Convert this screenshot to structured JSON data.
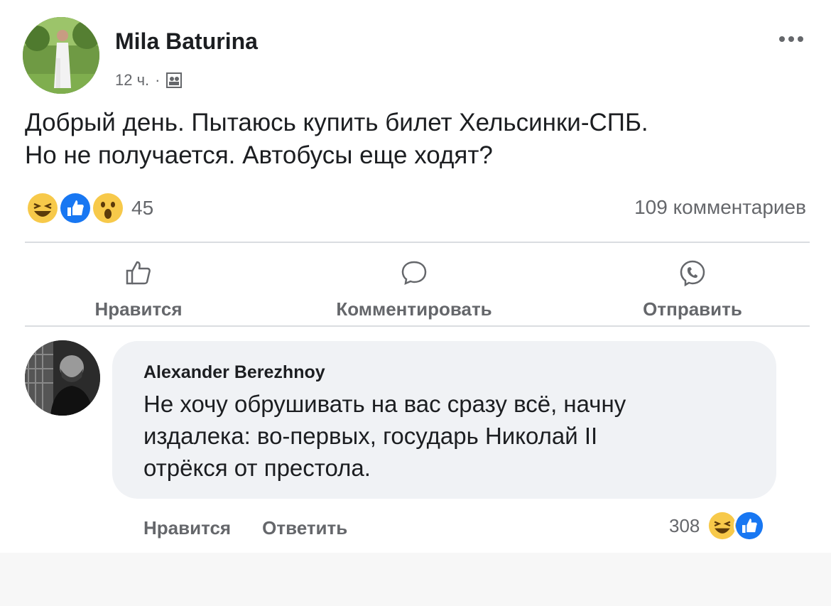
{
  "post": {
    "author": "Mila Baturina",
    "time": "12 ч.",
    "separator": "·",
    "text_line1": "Добрый день. Пытаюсь купить билет Хельсинки-СПБ.",
    "text_line2": "Но не получается. Автобусы еще ходят?",
    "reactions_count": "45",
    "reactions": [
      "haha-icon",
      "like-icon",
      "wow-icon"
    ],
    "comments_count": "109 комментариев"
  },
  "actions": {
    "like": "Нравится",
    "comment": "Комментировать",
    "send": "Отправить"
  },
  "comment": {
    "author": "Alexander Berezhnoy",
    "line1": "Не хочу обрушивать на вас сразу всё, начну",
    "line2": "издалека: во-первых, государь Николай II",
    "line3": "отрёкся от престола.",
    "like": "Нравится",
    "reply": "Ответить",
    "reactions_count": "308",
    "reactions": [
      "haha-icon",
      "like-icon"
    ]
  },
  "colors": {
    "like_blue": "#1877f2",
    "reaction_yellow": "#f7c94a",
    "text_secondary": "#65676b"
  }
}
